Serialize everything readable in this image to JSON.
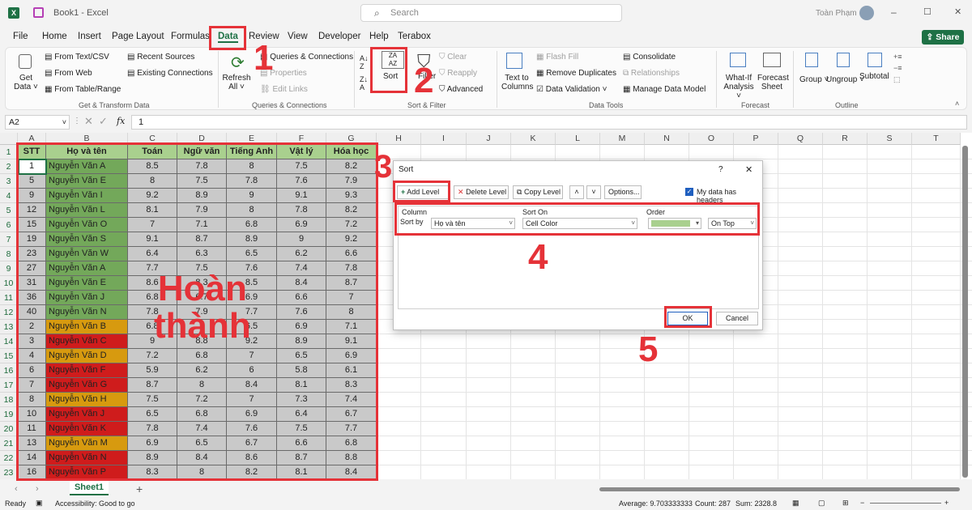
{
  "title": {
    "app_icon": "X",
    "workbook": "Book1 - Excel",
    "search_placeholder": "Search",
    "user": "Toàn Phạm",
    "min": "–",
    "max": "☐",
    "close": "✕"
  },
  "tabs": [
    "File",
    "Home",
    "Insert",
    "Page Layout",
    "Formulas",
    "Data",
    "Review",
    "View",
    "Developer",
    "Help",
    "Terabox"
  ],
  "share": "Share",
  "ribbon": {
    "get_data": "Get Data ˅",
    "from_text": "From Text/CSV",
    "from_web": "From Web",
    "from_table": "From Table/Range",
    "recent": "Recent Sources",
    "existing": "Existing Connections",
    "group1": "Get & Transform Data",
    "refresh": "Refresh All ˅",
    "queries": "Queries & Connections",
    "properties": "Properties",
    "edit_links": "Edit Links",
    "group2": "Queries & Connections",
    "sort": "Sort",
    "filter": "Filter",
    "clear": "Clear",
    "reapply": "Reapply",
    "advanced": "Advanced",
    "group3": "Sort & Filter",
    "ttc": "Text to Columns",
    "flash": "Flash Fill",
    "remove_dup": "Remove Duplicates",
    "data_val": "Data Validation ˅",
    "consolidate": "Consolidate",
    "relationships": "Relationships",
    "manage": "Manage Data Model",
    "group4": "Data Tools",
    "whatif": "What-If Analysis ˅",
    "forecast": "Forecast Sheet",
    "group5": "Forecast",
    "group_btn": "Group ˅",
    "ungroup": "Ungroup ˅",
    "subtotal": "Subtotal",
    "group6": "Outline"
  },
  "formula_bar": {
    "name_box": "A2",
    "fx": "fx",
    "value": "1"
  },
  "columns": [
    "A",
    "B",
    "C",
    "D",
    "E",
    "F",
    "G",
    "H",
    "I",
    "J",
    "K",
    "L",
    "M",
    "N",
    "O",
    "P",
    "Q",
    "R",
    "S",
    "T"
  ],
  "headers": [
    "STT",
    "Họ và tên",
    "Toán",
    "Ngữ văn",
    "Tiếng Anh",
    "Vật lý",
    "Hóa học"
  ],
  "rows": [
    {
      "n": "2",
      "stt": "1",
      "name": "Nguyễn Văn A",
      "c": "g",
      "v": [
        "8.5",
        "7.8",
        "8",
        "7.5",
        "8.2"
      ]
    },
    {
      "n": "3",
      "stt": "5",
      "name": "Nguyễn Văn E",
      "c": "g",
      "v": [
        "8",
        "7.5",
        "7.8",
        "7.6",
        "7.9"
      ]
    },
    {
      "n": "4",
      "stt": "9",
      "name": "Nguyễn Văn I",
      "c": "g",
      "v": [
        "9.2",
        "8.9",
        "9",
        "9.1",
        "9.3"
      ]
    },
    {
      "n": "5",
      "stt": "12",
      "name": "Nguyễn Văn L",
      "c": "g",
      "v": [
        "8.1",
        "7.9",
        "8",
        "7.8",
        "8.2"
      ]
    },
    {
      "n": "6",
      "stt": "15",
      "name": "Nguyễn Văn O",
      "c": "g",
      "v": [
        "7",
        "7.1",
        "6.8",
        "6.9",
        "7.2"
      ]
    },
    {
      "n": "7",
      "stt": "19",
      "name": "Nguyễn Văn S",
      "c": "g",
      "v": [
        "9.1",
        "8.7",
        "8.9",
        "9",
        "9.2"
      ]
    },
    {
      "n": "8",
      "stt": "23",
      "name": "Nguyễn Văn W",
      "c": "g",
      "v": [
        "6.4",
        "6.3",
        "6.5",
        "6.2",
        "6.6"
      ]
    },
    {
      "n": "9",
      "stt": "27",
      "name": "Nguyễn Văn A",
      "c": "g",
      "v": [
        "7.7",
        "7.5",
        "7.6",
        "7.4",
        "7.8"
      ]
    },
    {
      "n": "10",
      "stt": "31",
      "name": "Nguyễn Văn E",
      "c": "g",
      "v": [
        "8.6",
        "8.3",
        "8.5",
        "8.4",
        "8.7"
      ]
    },
    {
      "n": "11",
      "stt": "36",
      "name": "Nguyễn Văn J",
      "c": "g",
      "v": [
        "6.8",
        "6.7",
        "6.9",
        "6.6",
        "7"
      ]
    },
    {
      "n": "12",
      "stt": "40",
      "name": "Nguyễn Văn N",
      "c": "g",
      "v": [
        "7.8",
        "7.9",
        "7.7",
        "7.6",
        "8"
      ]
    },
    {
      "n": "13",
      "stt": "2",
      "name": "Nguyễn Văn B",
      "c": "o",
      "v": [
        "6.8",
        "7",
        "6.5",
        "6.9",
        "7.1"
      ]
    },
    {
      "n": "14",
      "stt": "3",
      "name": "Nguyễn Văn C",
      "c": "r",
      "v": [
        "9",
        "8.8",
        "9.2",
        "8.9",
        "9.1"
      ]
    },
    {
      "n": "15",
      "stt": "4",
      "name": "Nguyễn Văn D",
      "c": "o",
      "v": [
        "7.2",
        "6.8",
        "7",
        "6.5",
        "6.9"
      ]
    },
    {
      "n": "16",
      "stt": "6",
      "name": "Nguyễn Văn F",
      "c": "r",
      "v": [
        "5.9",
        "6.2",
        "6",
        "5.8",
        "6.1"
      ]
    },
    {
      "n": "17",
      "stt": "7",
      "name": "Nguyễn Văn G",
      "c": "r",
      "v": [
        "8.7",
        "8",
        "8.4",
        "8.1",
        "8.3"
      ]
    },
    {
      "n": "18",
      "stt": "8",
      "name": "Nguyễn Văn H",
      "c": "o",
      "v": [
        "7.5",
        "7.2",
        "7",
        "7.3",
        "7.4"
      ]
    },
    {
      "n": "19",
      "stt": "10",
      "name": "Nguyễn Văn J",
      "c": "r",
      "v": [
        "6.5",
        "6.8",
        "6.9",
        "6.4",
        "6.7"
      ]
    },
    {
      "n": "20",
      "stt": "11",
      "name": "Nguyễn Văn K",
      "c": "r",
      "v": [
        "7.8",
        "7.4",
        "7.6",
        "7.5",
        "7.7"
      ]
    },
    {
      "n": "21",
      "stt": "13",
      "name": "Nguyễn Văn M",
      "c": "o",
      "v": [
        "6.9",
        "6.5",
        "6.7",
        "6.6",
        "6.8"
      ]
    },
    {
      "n": "22",
      "stt": "14",
      "name": "Nguyễn Văn N",
      "c": "r",
      "v": [
        "8.9",
        "8.4",
        "8.6",
        "8.7",
        "8.8"
      ]
    },
    {
      "n": "23",
      "stt": "16",
      "name": "Nguyễn Văn P",
      "c": "r",
      "v": [
        "8.3",
        "8",
        "8.2",
        "8.1",
        "8.4"
      ]
    }
  ],
  "annotation_text": {
    "line1": "Hoàn",
    "line2": "thành"
  },
  "steps": [
    "1",
    "2",
    "3",
    "4",
    "5"
  ],
  "dialog": {
    "title": "Sort",
    "help": "?",
    "close": "✕",
    "add": "Add Level",
    "delete": "Delete Level",
    "copy": "Copy Level",
    "up": "˄",
    "down": "˅",
    "options": "Options...",
    "headers_check": "My data has headers",
    "col_col": "Column",
    "col_sorton": "Sort On",
    "col_order": "Order",
    "sortby": "Sort by",
    "column_value": "Họ và tên",
    "sorton_value": "Cell Color",
    "order_value": "On Top",
    "ok": "OK",
    "cancel": "Cancel"
  },
  "sheetbar": {
    "sheet": "Sheet1",
    "add": "+"
  },
  "status": {
    "ready": "Ready",
    "access": "Accessibility: Good to go",
    "average": "Average: 9.703333333",
    "count": "Count: 287",
    "sum": "Sum: 2328.8"
  },
  "colors": {
    "excel_green": "#1e7145",
    "green_cell": "#73a85a",
    "orange_cell": "#d79a0f",
    "red_cell": "#cf1c1c",
    "header_green": "#a9d08e",
    "annotation_red": "#e53238"
  }
}
